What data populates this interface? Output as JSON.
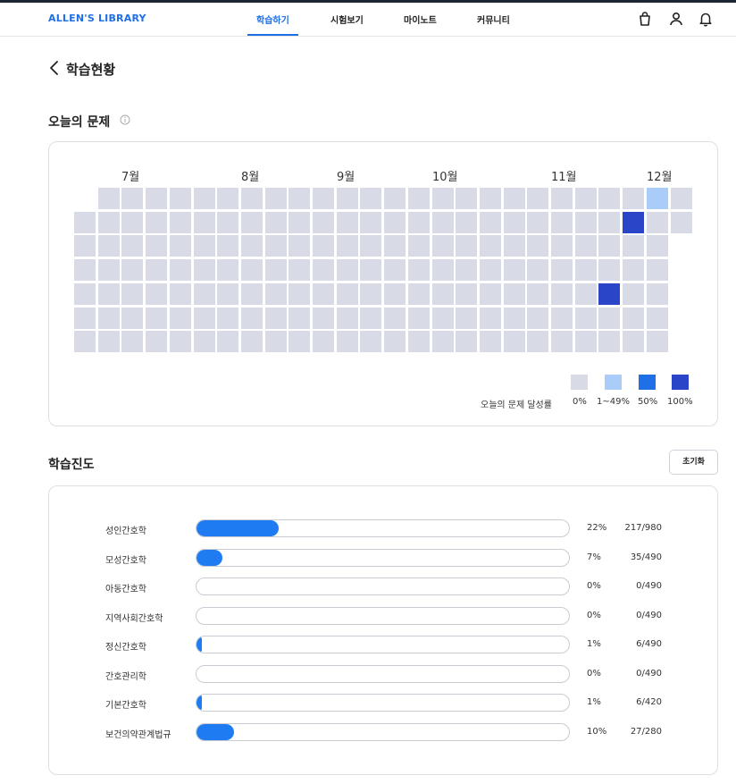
{
  "header": {
    "logo": "ALLEN'S LIBRARY",
    "nav": [
      {
        "label": "학습하기",
        "active": true
      },
      {
        "label": "시험보기",
        "active": false
      },
      {
        "label": "마이노트",
        "active": false
      },
      {
        "label": "커뮤니티",
        "active": false
      }
    ],
    "icons": [
      "shopping-bag-icon",
      "user-icon",
      "bell-icon"
    ]
  },
  "page": {
    "title": "학습현황"
  },
  "today": {
    "title": "오늘의 문제",
    "months": [
      "7월",
      "8월",
      "9월",
      "10월",
      "11월",
      "12월"
    ],
    "grid": {
      "columns": 26,
      "rows": 7,
      "highlighted": [
        {
          "col": 24,
          "row": 0,
          "level": "low"
        },
        {
          "col": 23,
          "row": 1,
          "level": "full"
        },
        {
          "col": 22,
          "row": 4,
          "level": "full"
        }
      ]
    },
    "legend": {
      "label": "오늘의 문제 달성률",
      "items": [
        {
          "label": "0%",
          "color": "#d8dbe6"
        },
        {
          "label": "1~49%",
          "color": "#a9ccf8"
        },
        {
          "label": "50%",
          "color": "#1f6fe6"
        },
        {
          "label": "100%",
          "color": "#2b45c8"
        }
      ]
    }
  },
  "progress": {
    "title": "학습진도",
    "reset_label": "초기화",
    "subjects": [
      {
        "name": "성인간호학",
        "percent": "22%",
        "count": "217/980",
        "fraction": 0.22
      },
      {
        "name": "모성간호학",
        "percent": "7%",
        "count": "35/490",
        "fraction": 0.07
      },
      {
        "name": "아동간호학",
        "percent": "0%",
        "count": "0/490",
        "fraction": 0
      },
      {
        "name": "지역사회간호학",
        "percent": "0%",
        "count": "0/490",
        "fraction": 0
      },
      {
        "name": "정신간호학",
        "percent": "1%",
        "count": "6/490",
        "fraction": 0.01
      },
      {
        "name": "간호관리학",
        "percent": "0%",
        "count": "0/490",
        "fraction": 0
      },
      {
        "name": "기본간호학",
        "percent": "1%",
        "count": "6/420",
        "fraction": 0.01
      },
      {
        "name": "보건의약관계법규",
        "percent": "10%",
        "count": "27/280",
        "fraction": 0.1
      }
    ]
  },
  "colors": {
    "accent": "#1f6fe6",
    "bar": "#1f7bf2",
    "empty_cell": "#d8dbe6"
  }
}
